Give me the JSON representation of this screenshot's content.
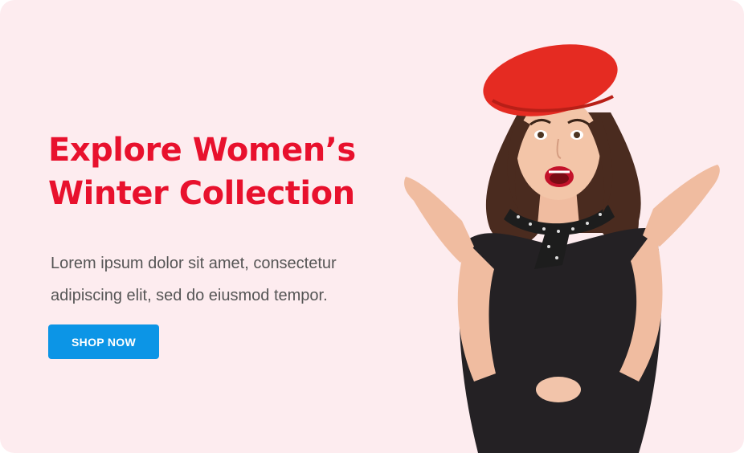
{
  "hero": {
    "heading_line1": "Explore Women’s",
    "heading_line2": "Winter Collection",
    "description_line1": "Lorem ipsum dolor sit amet, consectetur",
    "description_line2": "adipiscing elit, sed do eiusmod tempor.",
    "cta_label": "SHOP NOW"
  },
  "colors": {
    "background": "#fdecef",
    "heading": "#e8112d",
    "cta": "#0c95e6",
    "beret": "#e52b22",
    "dress": "#242124"
  },
  "image": {
    "subject": "woman-in-red-beret-icon"
  }
}
